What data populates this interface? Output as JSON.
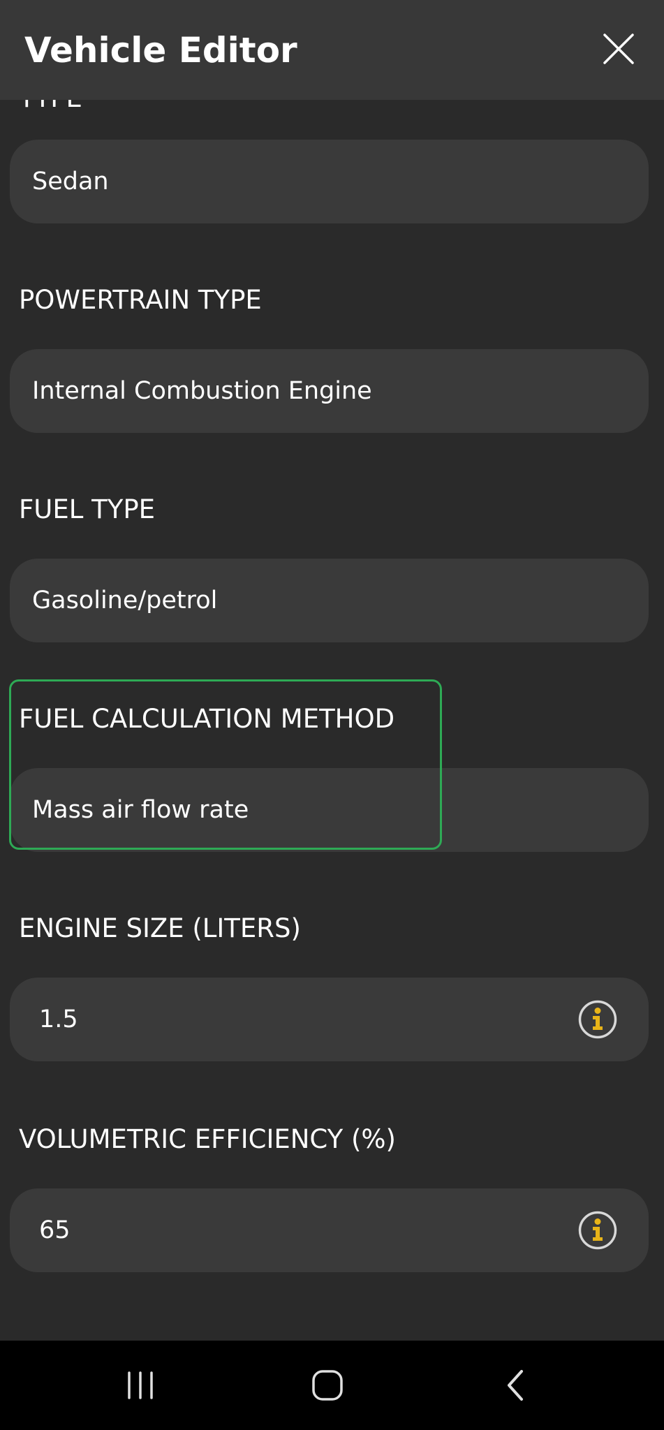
{
  "header": {
    "title": "Vehicle Editor",
    "close_icon": "close-icon"
  },
  "form": {
    "partial_label": "TYPE",
    "fields": [
      {
        "label": "",
        "value": "Sedan"
      },
      {
        "label": "POWERTRAIN TYPE",
        "value": "Internal Combustion Engine"
      },
      {
        "label": "FUEL TYPE",
        "value": "Gasoline/petrol"
      },
      {
        "label": "FUEL CALCULATION METHOD",
        "value": "Mass air flow rate",
        "highlighted": true
      },
      {
        "label": "ENGINE SIZE (LITERS)",
        "value": "1.5",
        "icon": "info-icon"
      },
      {
        "label": "VOLUMETRIC EFFICIENCY (%)",
        "value": "65",
        "icon": "info-icon"
      }
    ]
  },
  "nav": {
    "recents_icon": "recents-icon",
    "home_icon": "home-icon",
    "back_icon": "back-icon"
  },
  "colors": {
    "background": "#2a2a2a",
    "header": "#383838",
    "field": "#3a3a3a",
    "highlight": "#2eaa55",
    "info_accent": "#e8b418",
    "nav_bar": "#000000"
  }
}
